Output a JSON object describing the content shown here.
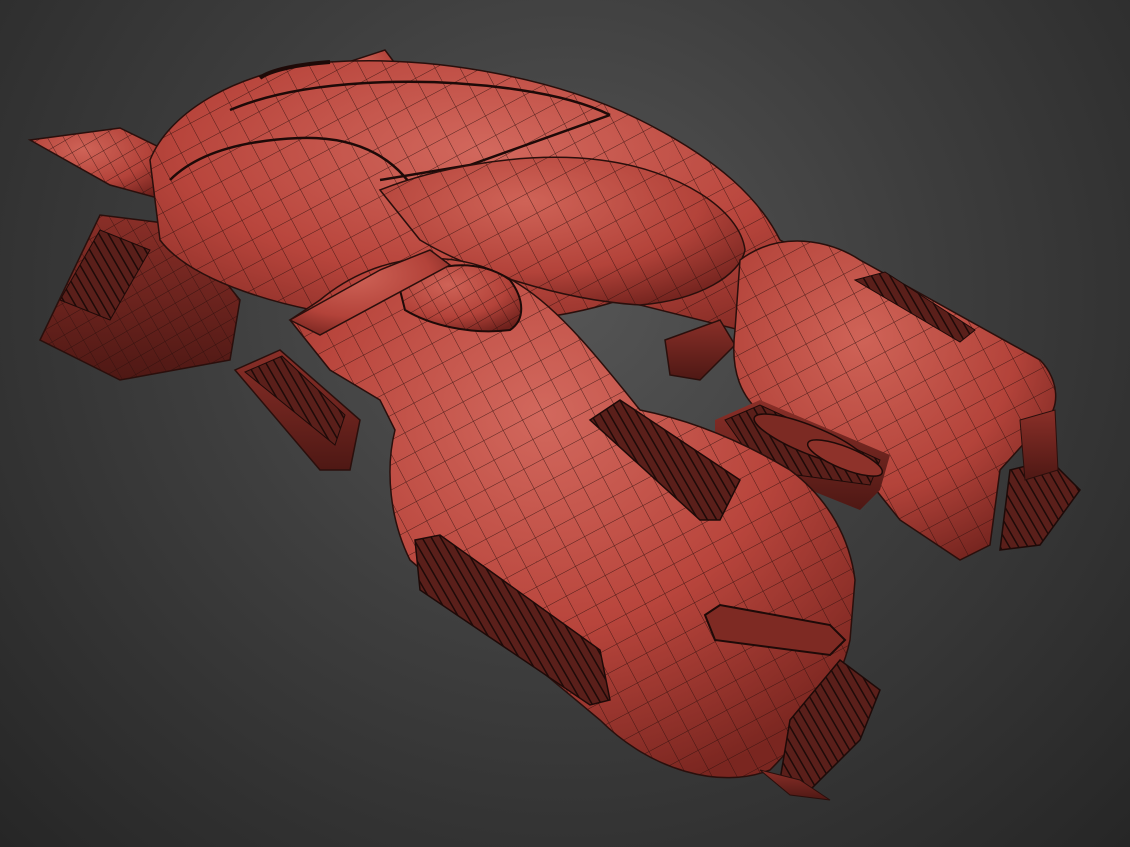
{
  "scene": {
    "background_color": "#3a3a3a",
    "model_color": "#b8453c",
    "wire_color": "#2a0f0c"
  }
}
